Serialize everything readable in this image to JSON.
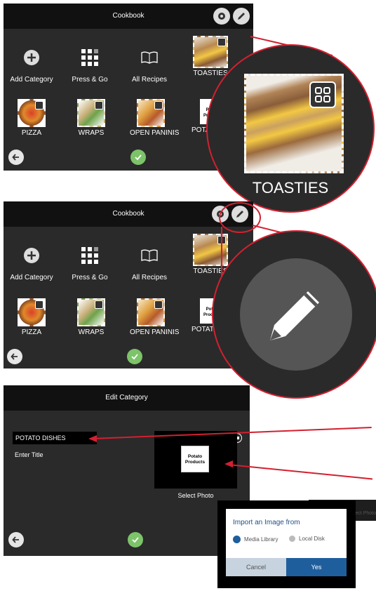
{
  "screen1": {
    "title": "Cookbook",
    "tiles": [
      {
        "label": "Add Category",
        "icon": "plus-circle-icon"
      },
      {
        "label": "Press & Go",
        "icon": "grid-icon"
      },
      {
        "label": "All Recipes",
        "icon": "book-icon"
      },
      {
        "label": "TOASTIES",
        "icon": "sandwich-thumbnail"
      }
    ],
    "row2": [
      {
        "label": "PIZZA"
      },
      {
        "label": "WRAPS"
      },
      {
        "label": "OPEN PANINIS"
      },
      {
        "label": "POTATO DISHES"
      }
    ],
    "callout_label": "TOASTIES"
  },
  "screen2": {
    "title": "Cookbook",
    "tiles": [
      {
        "label": "Add Category"
      },
      {
        "label": "Press & Go"
      },
      {
        "label": "All Recipes"
      },
      {
        "label": "TOASTIES"
      }
    ],
    "row2": [
      {
        "label": "PIZZA"
      },
      {
        "label": "WRAPS"
      },
      {
        "label": "OPEN PANINIS"
      },
      {
        "label": "POTATO DISHES"
      }
    ]
  },
  "screen3": {
    "title": "Edit Category",
    "category_value": "POTATO DISHES",
    "enter_title": "Enter Title",
    "photo_text_line1": "Potato",
    "photo_text_line2": "Products",
    "select_photo": "Select Photo",
    "faded_label": "Select Photo"
  },
  "dialog": {
    "title": "Import an Image from",
    "option1": "Media Library",
    "option2": "Local Disk",
    "cancel": "Cancel",
    "yes": "Yes"
  },
  "colors": {
    "accent": "#d3202f",
    "ok": "#7dc36a",
    "yes": "#1f5e9c"
  }
}
